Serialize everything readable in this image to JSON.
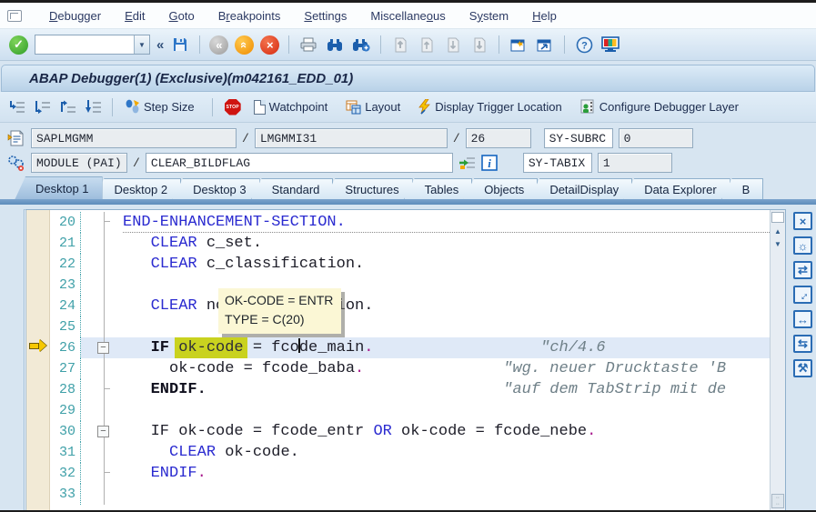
{
  "window": {
    "title": "ABAP Debugger(1)  (Exclusive)(m042161_EDD_01)"
  },
  "menu": {
    "items": [
      {
        "label": "Debugger",
        "u": 0
      },
      {
        "label": "Edit",
        "u": 0
      },
      {
        "label": "Goto",
        "u": 0
      },
      {
        "label": "Breakpoints",
        "u": 1
      },
      {
        "label": "Settings",
        "u": 0
      },
      {
        "label": "Miscellaneous",
        "u": 10
      },
      {
        "label": "System",
        "u": 1
      },
      {
        "label": "Help",
        "u": 0
      }
    ]
  },
  "toolbar": {
    "command_value": ""
  },
  "debug_toolbar": {
    "step_size": "Step Size",
    "watchpoint": "Watchpoint",
    "layout": "Layout",
    "display_trigger": "Display Trigger Location",
    "configure_layer": "Configure Debugger Layer"
  },
  "context": {
    "program": "SAPLMGMM",
    "include": "LMGMMI31",
    "line": "26",
    "slash": "/",
    "sy_subrc_label": "SY-SUBRC",
    "sy_subrc_value": "0",
    "event_type": "MODULE (PAI)",
    "event_name": "CLEAR_BILDFLAG",
    "sy_tabix_label": "SY-TABIX",
    "sy_tabix_value": "1"
  },
  "tabs": {
    "active": 0,
    "items": [
      "Desktop 1",
      "Desktop 2",
      "Desktop 3",
      "Standard",
      "Structures",
      "Tables",
      "Objects",
      "DetailDisplay",
      "Data Explorer",
      "B"
    ]
  },
  "tooltip": {
    "line1": "OK-CODE = ENTR",
    "line2": "TYPE  = C(20)"
  },
  "editor": {
    "lines": [
      {
        "n": "20",
        "fold": "end",
        "dotted": true,
        "segs": [
          {
            "t": "END-ENHANCEMENT-SECTION.",
            "c": "kw"
          }
        ]
      },
      {
        "n": "21",
        "segs": [
          {
            "t": "   "
          },
          {
            "t": "CLEAR",
            "c": "kw"
          },
          {
            "t": " c_set."
          }
        ]
      },
      {
        "n": "22",
        "segs": [
          {
            "t": "   "
          },
          {
            "t": "CLEAR",
            "c": "kw"
          },
          {
            "t": " c_classification."
          }
        ]
      },
      {
        "n": "23",
        "segs": []
      },
      {
        "n": "24",
        "segs": [
          {
            "t": "   "
          },
          {
            "t": "CLEAR",
            "c": "kw"
          },
          {
            "t": " no_classification."
          }
        ]
      },
      {
        "n": "25",
        "segs": []
      },
      {
        "n": "26",
        "fold": "open",
        "current": true,
        "arrow": true,
        "segs": [
          {
            "t": "   "
          },
          {
            "t": "IF",
            "c": "kwb"
          },
          {
            "t": " "
          },
          {
            "t": "ok-code",
            "c": "hl"
          },
          {
            "t": " = fco"
          },
          {
            "t": "",
            "c": "caret"
          },
          {
            "t": "de_main"
          },
          {
            "t": ".",
            "c": "dot"
          },
          {
            "t": "                  "
          },
          {
            "t": "\"ch/4.6",
            "c": "cmt"
          }
        ]
      },
      {
        "n": "27",
        "segs": [
          {
            "t": "     ok-code = fcode_baba"
          },
          {
            "t": ".",
            "c": "dot"
          },
          {
            "t": "               "
          },
          {
            "t": "\"wg. neuer Drucktaste 'B",
            "c": "cmt"
          }
        ]
      },
      {
        "n": "28",
        "fold": "close",
        "segs": [
          {
            "t": "   "
          },
          {
            "t": "ENDIF.",
            "c": "kwb"
          },
          {
            "t": "                                "
          },
          {
            "t": "\"auf dem TabStrip mit de",
            "c": "cmt"
          }
        ]
      },
      {
        "n": "29",
        "segs": []
      },
      {
        "n": "30",
        "fold": "open",
        "segs": [
          {
            "t": "   IF ok-code = fcode_entr "
          },
          {
            "t": "OR",
            "c": "kw"
          },
          {
            "t": " ok-code = fcode_nebe"
          },
          {
            "t": ".",
            "c": "dot"
          }
        ]
      },
      {
        "n": "31",
        "segs": [
          {
            "t": "     "
          },
          {
            "t": "CLEAR",
            "c": "kw"
          },
          {
            "t": " ok-code."
          }
        ]
      },
      {
        "n": "32",
        "fold": "close",
        "segs": [
          {
            "t": "   "
          },
          {
            "t": "ENDIF",
            "c": "kw"
          },
          {
            "t": ".",
            "c": "dot"
          }
        ]
      },
      {
        "n": "33",
        "segs": []
      }
    ]
  },
  "side_icons": [
    {
      "name": "close-icon",
      "glyph": "×"
    },
    {
      "name": "new-window-icon",
      "glyph": "☼"
    },
    {
      "name": "swap-windows-icon",
      "glyph": "⇄"
    },
    {
      "name": "maximize-icon",
      "glyph": "↔",
      "rot": true
    },
    {
      "name": "fit-width-icon",
      "glyph": "↔"
    },
    {
      "name": "exchange-icon",
      "glyph": "⇆"
    },
    {
      "name": "services-icon",
      "glyph": "⚒"
    }
  ],
  "colors": {
    "keyword": "#2b2bd0",
    "comment": "#6e7f87",
    "line_number": "#3fa0a8",
    "highlight": "#c9d21f",
    "current_line": "#dfe9f7",
    "statement_dot": "#a8188c"
  }
}
